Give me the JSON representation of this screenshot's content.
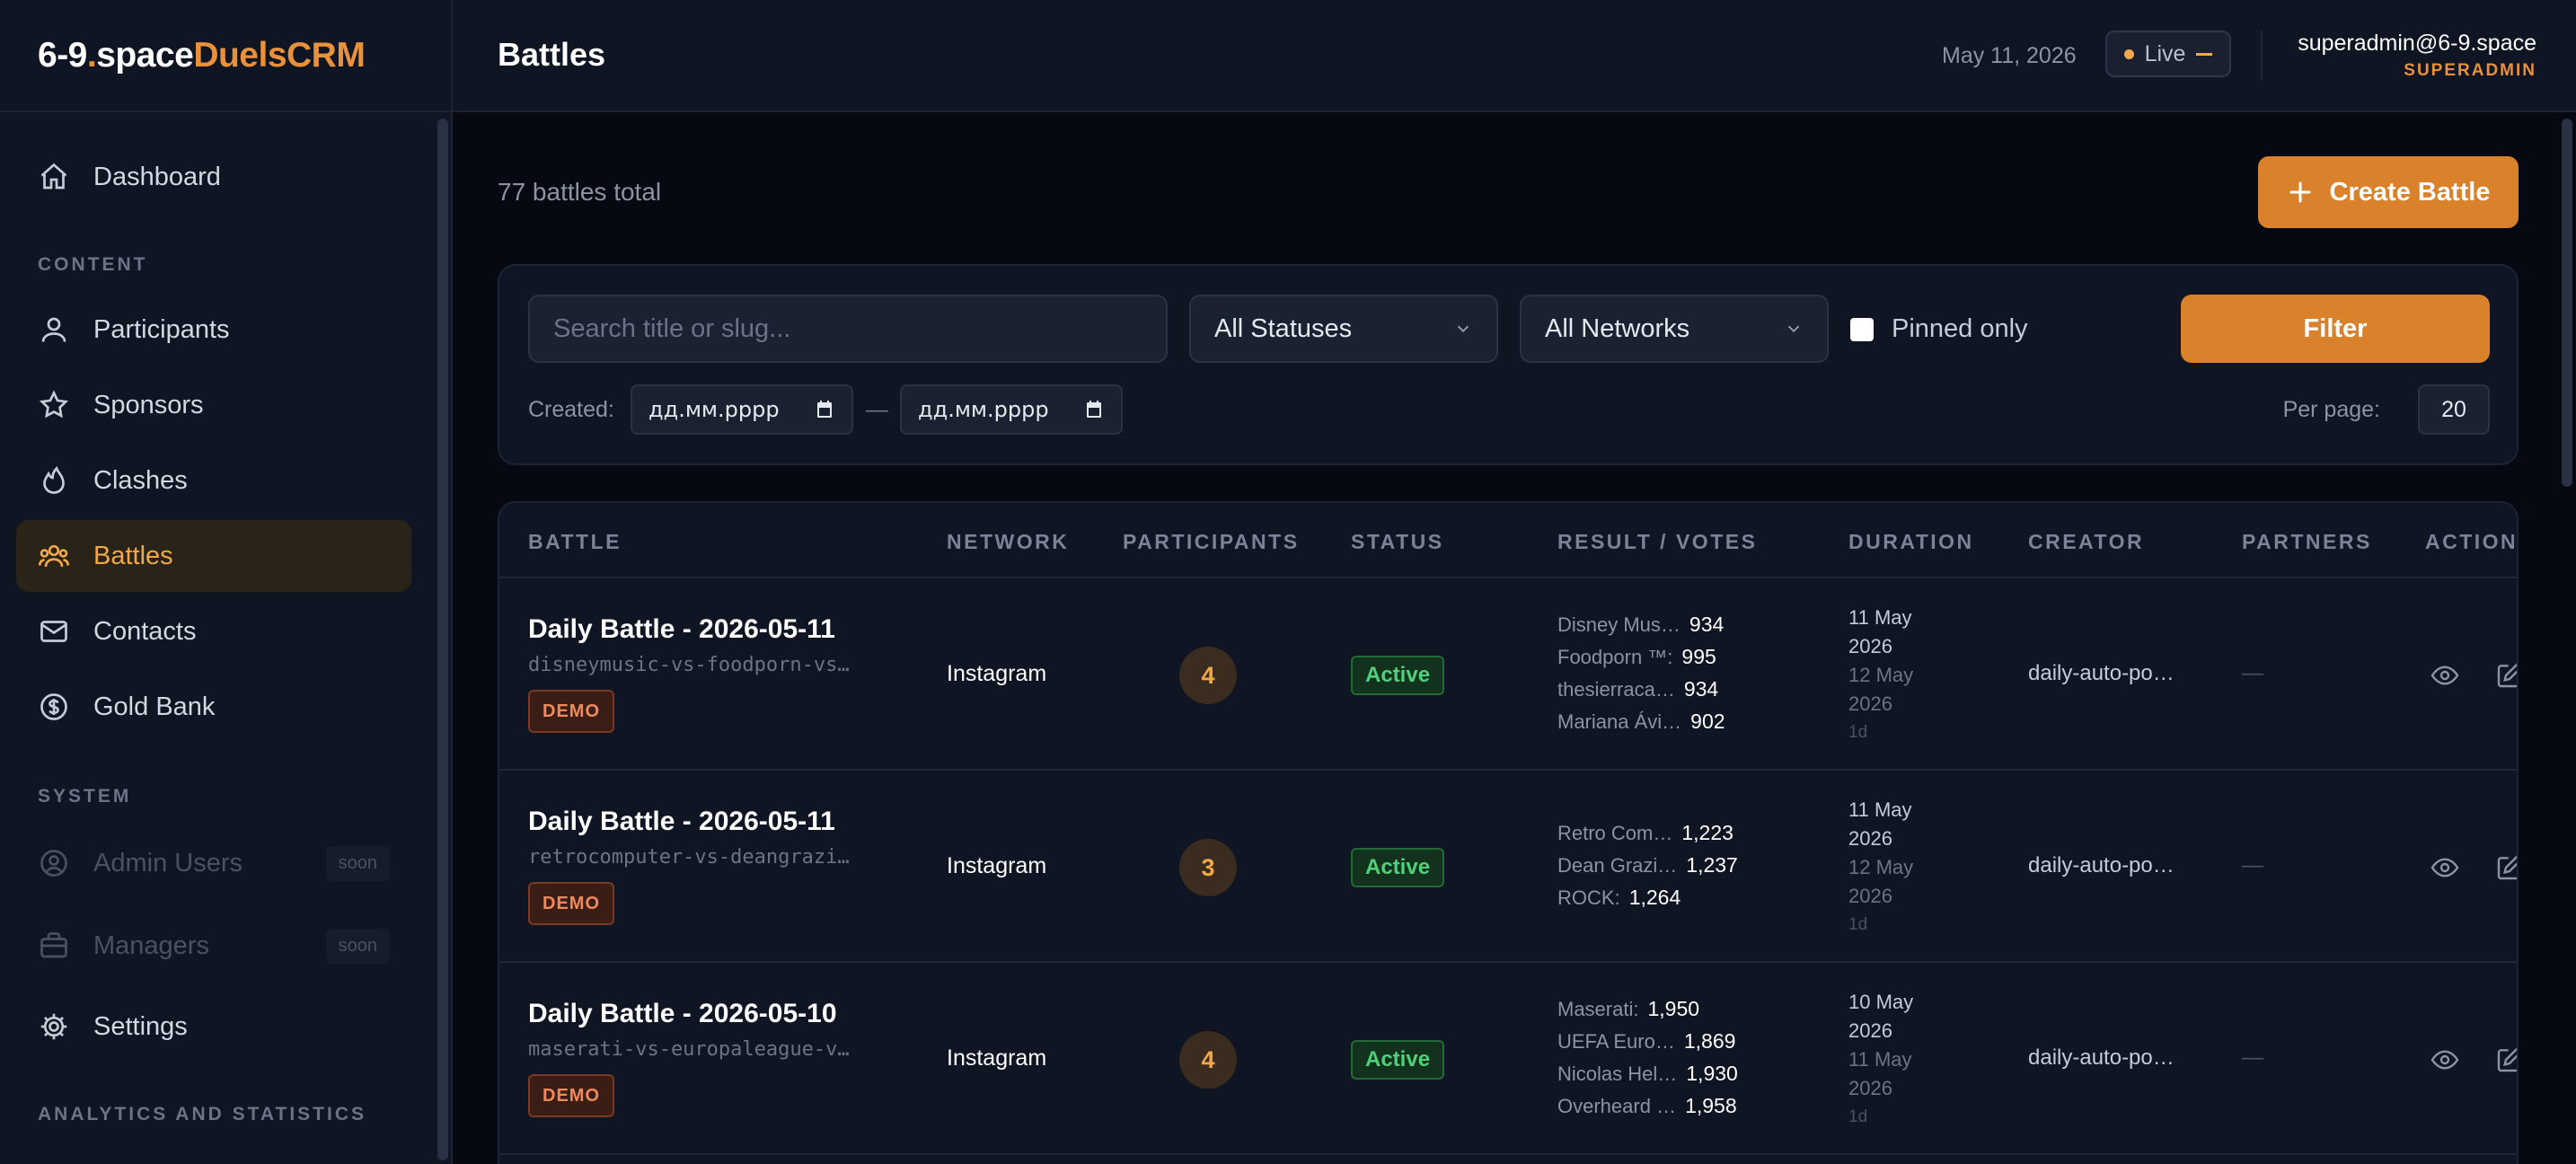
{
  "brand": {
    "part1": "6-9",
    "dot": ".",
    "part2": "space",
    "part3": " DuelsCRM"
  },
  "sidebar": {
    "items": [
      {
        "label": "Dashboard"
      },
      {
        "label": "Participants"
      },
      {
        "label": "Sponsors"
      },
      {
        "label": "Clashes"
      },
      {
        "label": "Battles"
      },
      {
        "label": "Contacts"
      },
      {
        "label": "Gold Bank"
      },
      {
        "label": "Admin Users",
        "badge": "soon"
      },
      {
        "label": "Managers",
        "badge": "soon"
      },
      {
        "label": "Settings"
      }
    ],
    "sections": {
      "content": "CONTENT",
      "system": "SYSTEM",
      "analytics": "ANALYTICS AND STATISTICS"
    }
  },
  "header": {
    "title": "Battles",
    "date": "May 11, 2026",
    "live_label": "Live",
    "user_email": "superadmin@6-9.space",
    "user_role": "SUPERADMIN"
  },
  "toolbar": {
    "total": "77 battles total",
    "create_label": "Create Battle"
  },
  "filters": {
    "search_placeholder": "Search title or slug...",
    "status_value": "All Statuses",
    "network_value": "All Networks",
    "pinned_label": "Pinned only",
    "filter_label": "Filter",
    "created_label": "Created:",
    "date_from": "дд.мм.рррр",
    "date_sep": "—",
    "date_to": "дд.мм.рррр",
    "per_page_label": "Per page:",
    "per_page_value": "20"
  },
  "table": {
    "columns": [
      "BATTLE",
      "NETWORK",
      "PARTICIPANTS",
      "STATUS",
      "RESULT / VOTES",
      "DURATION",
      "CREATOR",
      "PARTNERS",
      "ACTIONS"
    ],
    "rows": [
      {
        "title": "Daily Battle - 2026-05-11",
        "slug": "disneymusic-vs-foodporn-vs…",
        "tag": "DEMO",
        "network": "Instagram",
        "participants": "4",
        "status": "Active",
        "votes": [
          {
            "name": "Disney Mus…",
            "count": "934"
          },
          {
            "name": "Foodporn ™:",
            "count": "995"
          },
          {
            "name": "thesierraca…",
            "count": "934"
          },
          {
            "name": "Mariana Ávi…",
            "count": "902"
          }
        ],
        "start": "11 May 2026",
        "end": "12 May 2026",
        "length": "1d",
        "creator": "daily-auto-po…",
        "partners": "—"
      },
      {
        "title": "Daily Battle - 2026-05-11",
        "slug": "retrocomputer-vs-deangrazi…",
        "tag": "DEMO",
        "network": "Instagram",
        "participants": "3",
        "status": "Active",
        "votes": [
          {
            "name": "Retro Com…",
            "count": "1,223"
          },
          {
            "name": "Dean Grazi…",
            "count": "1,237"
          },
          {
            "name": "ROCK:",
            "count": "1,264"
          }
        ],
        "start": "11 May 2026",
        "end": "12 May 2026",
        "length": "1d",
        "creator": "daily-auto-po…",
        "partners": "—"
      },
      {
        "title": "Daily Battle - 2026-05-10",
        "slug": "maserati-vs-europaleague-v…",
        "tag": "DEMO",
        "network": "Instagram",
        "participants": "4",
        "status": "Active",
        "votes": [
          {
            "name": "Maserati:",
            "count": "1,950"
          },
          {
            "name": "UEFA Euro…",
            "count": "1,869"
          },
          {
            "name": "Nicolas Hel…",
            "count": "1,930"
          },
          {
            "name": "Overheard …",
            "count": "1,958"
          }
        ],
        "start": "10 May 2026",
        "end": "11 May 2026",
        "length": "1d",
        "creator": "daily-auto-po…",
        "partners": "—"
      }
    ]
  }
}
